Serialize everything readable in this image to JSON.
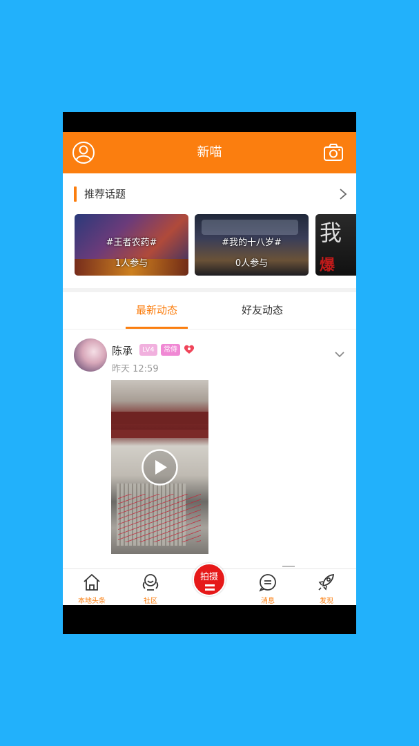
{
  "header": {
    "title": "新喵"
  },
  "topics": {
    "heading": "推荐话题",
    "cards": [
      {
        "tag": "#王者农药#",
        "count": "1人参与"
      },
      {
        "tag": "#我的十八岁#",
        "count": "0人参与"
      },
      {
        "tag": "#",
        "count": ""
      }
    ],
    "card3_text": "我",
    "card3_red": "爆"
  },
  "tabs": {
    "latest": "最新动态",
    "friends": "好友动态"
  },
  "post": {
    "username": "陈承",
    "level_badge": "LV4",
    "role_badge": "常侍",
    "time": "昨天 12:59"
  },
  "bottom_nav": {
    "home": "本地头条",
    "community": "社区",
    "shoot": "拍摄",
    "messages": "消息",
    "discover": "发现"
  },
  "colors": {
    "accent": "#fb7e0f",
    "background": "#22b1fb",
    "shoot_button": "#e61919"
  }
}
